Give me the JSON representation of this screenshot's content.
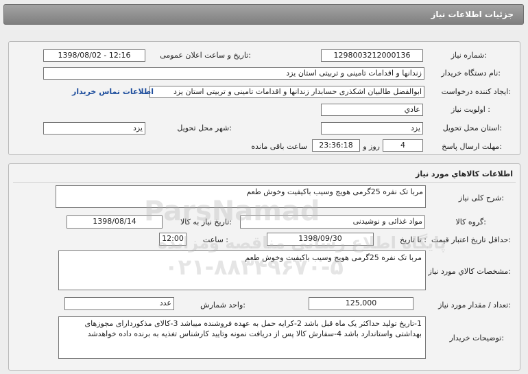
{
  "page_title": "جزئيات اطلاعات نياز",
  "info": {
    "need_number_label": "شماره نياز:",
    "need_number": "1298003212000136",
    "announce_label": "تاريخ و ساعت اعلان عمومی:",
    "announce_value": "1398/08/02 - 12:16",
    "buyer_org_label": "نام دستگاه خريدار:",
    "buyer_org": "زندانها و اقدامات تامينی و تربيتی استان يزد",
    "creator_label": "ايجاد کننده درخواست:",
    "creator": "ابوالفضل  طالبيان اشکذری حسابدار زندانها و اقدامات تامينی و تربيتی استان يزد",
    "contact_link": "اطلاعات تماس خريدار",
    "priority_label": "اولويت نياز :",
    "priority": "عادي",
    "province_label": "استان محل تحويل:",
    "province": "يزد",
    "city_label": "شهر محل تحويل:",
    "city": "يزد",
    "deadline_label": "مهلت ارسال پاسخ:",
    "deadline_days": "4",
    "days_word": "روز و",
    "deadline_time": "23:36:18",
    "remaining_label": "ساعت باقی مانده"
  },
  "goods": {
    "section_title": "اطلاعات کالاهاي مورد نياز",
    "summary_label": "شرح کلی نياز:",
    "summary": "مربا تک نفره 25گرمی هويج وسيب باکيفيت وخوش طعم",
    "group_label": "گروه کالا:",
    "group": "مواد غذائی و نوشيدنی",
    "need_date_label": "تاريخ نياز به کالا:",
    "need_date": "1398/08/14",
    "min_validity_label": "حداقل تاريخ اعتبار قيمت:",
    "to_date_label": "تا تاريخ :",
    "validity_date": "1398/09/30",
    "time_label": "ساعت :",
    "validity_time": "12:00",
    "spec_label": "مشخصات کالاي مورد نياز:",
    "spec": "مربا تک نفره 25گرمی هويج وسيب باکيفيت وخوش طعم",
    "qty_label": "تعداد / مقدار مورد نياز:",
    "qty": "125,000",
    "unit_label": "واحد شمارش:",
    "unit": "عدد",
    "notes_label": "توضيحات خريدار:",
    "notes": "1-تاریخ تولید حداکثر یک ماه قبل باشد 2-کرایه حمل به عهده فروشنده میباشد 3-کالای مذکوردارای مجوزهای بهداشتی واستاندارد  باشد 4-سفارش کالا پس از دریافت نمونه وتایید کارشناس تغذیه به برنده داده خواهدشد"
  },
  "watermark": {
    "brand": "ParsNamad",
    "line1": "پایگاه اطلاع رسانی مناقصه ومزایده",
    "phone": "۰۲۱-۸۸۳۴۹۶۷۰-۵"
  }
}
